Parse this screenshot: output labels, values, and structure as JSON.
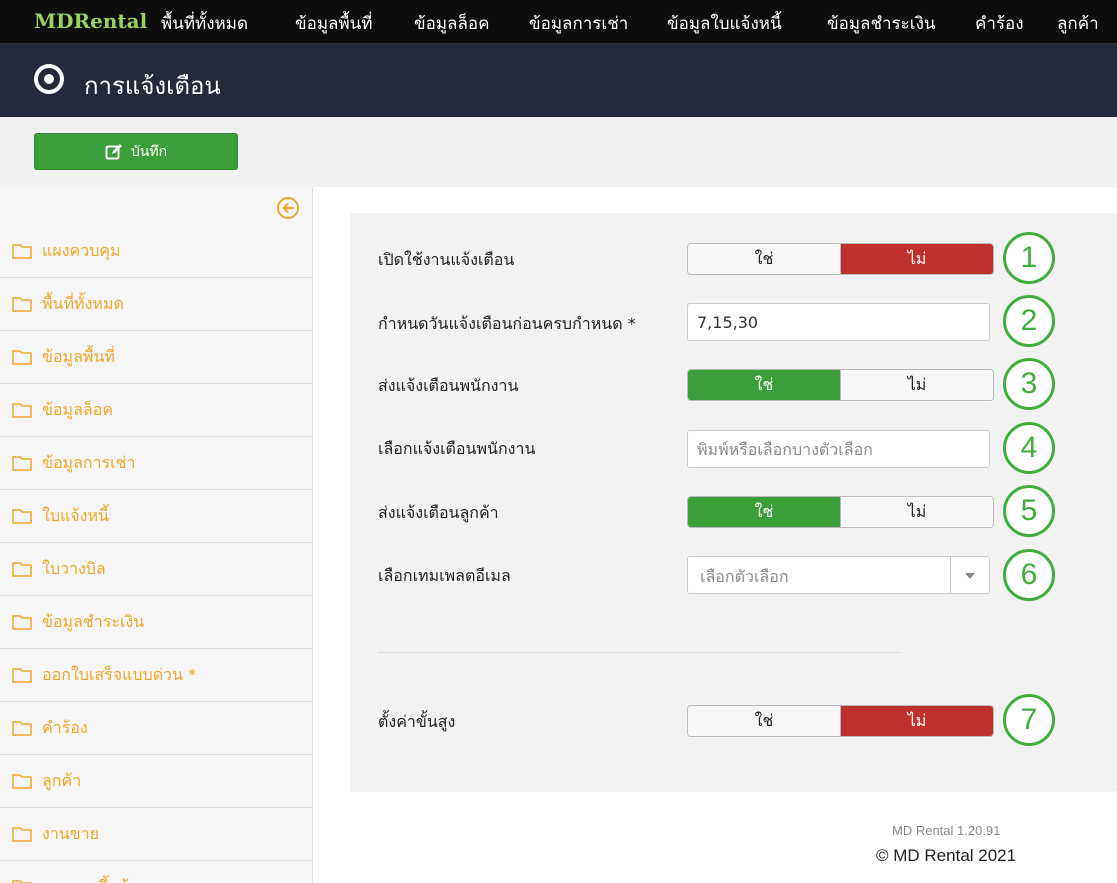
{
  "nav": {
    "brand": "MDRental",
    "items": [
      "พื้นที่ทั้งหมด",
      "ข้อมูลพื้นที่",
      "ข้อมูลล็อค",
      "ข้อมูลการเช่า",
      "ข้อมูลใบแจ้งหนี้",
      "ข้อมูลชำระเงิน",
      "คำร้อง",
      "ลูกค้า"
    ]
  },
  "header": {
    "title": "การแจ้งเตือน",
    "icon": "dot-circle-icon"
  },
  "toolbar": {
    "save_label": "บันทึก",
    "save_icon": "edit-icon"
  },
  "sidebar": {
    "collapse_icon": "arrow-circle-left-icon",
    "items": [
      "แผงควบคุม",
      "พื้นที่ทั้งหมด",
      "ข้อมูลพื้นที่",
      "ข้อมูลล็อค",
      "ข้อมูลการเช่า",
      "ใบแจ้งหนี้",
      "ใบวางบิล",
      "ข้อมูลชำระเงิน",
      "ออกใบเสร็จแบบด่วน *",
      "คำร้อง",
      "ลูกค้า",
      "งานขาย",
      "รายงานขึ้นต้น"
    ]
  },
  "form": {
    "enable_notify": {
      "label": "เปิดใช้งานแจ้งเตือน",
      "yes": "ใช่",
      "no": "ไม่",
      "selected": "no"
    },
    "days_before": {
      "label": "กำหนดวันแจ้งเตือนก่อนครบกำหนด *",
      "value": "7,15,30"
    },
    "notify_staff": {
      "label": "ส่งแจ้งเตือนพนักงาน",
      "yes": "ใช่",
      "no": "ไม่",
      "selected": "yes"
    },
    "select_staff": {
      "label": "เลือกแจ้งเตือนพนักงาน",
      "placeholder": "พิมพ์หรือเลือกบางตัวเลือก"
    },
    "notify_customer": {
      "label": "ส่งแจ้งเตือนลูกค้า",
      "yes": "ใช่",
      "no": "ไม่",
      "selected": "yes"
    },
    "email_template": {
      "label": "เลือกเทมเพลตอีเมล",
      "placeholder": "เลือกตัวเลือก"
    },
    "advanced": {
      "label": "ตั้งค่าขั้นสูง",
      "yes": "ใช่",
      "no": "ไม่",
      "selected": "no"
    }
  },
  "badges": [
    "1",
    "2",
    "3",
    "4",
    "5",
    "6",
    "7"
  ],
  "footer": {
    "version": "MD Rental 1.20.91",
    "copyright": "© MD Rental 2021"
  },
  "colors": {
    "brand": "#9bd15d",
    "header_bg": "#252a3a",
    "save_green": "#3a9e3a",
    "no_red": "#c0302c",
    "sidebar_text": "#f0a82a",
    "badge_green": "#3fae3a"
  }
}
